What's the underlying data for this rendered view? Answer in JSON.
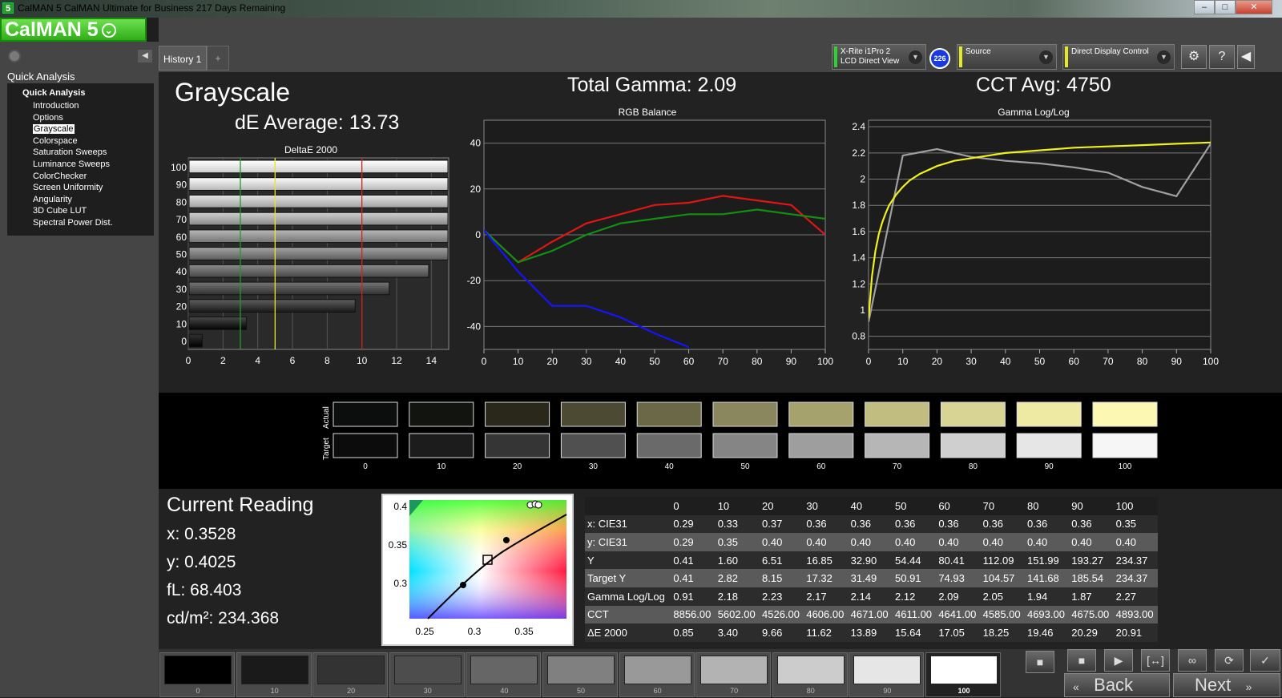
{
  "window": {
    "title": "CalMAN 5 CalMAN Ultimate for Business 217 Days Remaining",
    "app_icon": "5",
    "minimize": "–",
    "maximize": "□",
    "close": "✕"
  },
  "logo": {
    "text": "CalMAN 5",
    "caret": "⌄"
  },
  "sidebar": {
    "heading": "Quick Analysis",
    "collapse": "◀",
    "root": "Quick Analysis",
    "items": [
      "Introduction",
      "Options",
      "Grayscale",
      "Colorspace",
      "Saturation Sweeps",
      "Luminance Sweeps",
      "ColorChecker",
      "Screen Uniformity",
      "Angularity",
      "3D Cube LUT",
      "Spectral Power Dist."
    ],
    "selected": "Grayscale"
  },
  "tabs": [
    {
      "label": "History 1"
    }
  ],
  "tab_add": "+",
  "devices": {
    "meter": {
      "line1": "X-Rite i1Pro 2",
      "line2": "LCD Direct View",
      "color": "#2fd12f"
    },
    "badge": "226",
    "source": {
      "label": "Source",
      "color": "#e6e62a"
    },
    "display": {
      "label": "Direct Display Control",
      "color": "#e6e62a"
    }
  },
  "toolbar": {
    "settings": "⚙",
    "help": "?",
    "collapse": "◀"
  },
  "headings": {
    "title": "Grayscale",
    "de_avg": "dE Average: 13.73",
    "gamma": "Total Gamma: 2.09",
    "cct": "CCT Avg: 4750"
  },
  "chart_data": [
    {
      "type": "bar",
      "title": "DeltaE 2000",
      "orientation": "horizontal",
      "categories": [
        100,
        90,
        80,
        70,
        60,
        50,
        40,
        30,
        20,
        10,
        0
      ],
      "values": [
        20.91,
        20.29,
        19.46,
        18.25,
        17.05,
        15.64,
        13.89,
        11.62,
        9.66,
        3.4,
        0.85
      ],
      "xlim": [
        0,
        15
      ],
      "xticks": [
        0,
        2,
        4,
        6,
        8,
        10,
        12,
        14
      ],
      "thresholds": [
        {
          "value": 3,
          "color": "#1fa01f"
        },
        {
          "value": 5,
          "color": "#e6e62a"
        },
        {
          "value": 10,
          "color": "#d42020"
        }
      ],
      "grid": true
    },
    {
      "type": "line",
      "title": "RGB Balance",
      "x": [
        0,
        10,
        20,
        30,
        40,
        50,
        60,
        70,
        80,
        90,
        100
      ],
      "xticks": [
        0,
        10,
        20,
        30,
        40,
        50,
        60,
        70,
        80,
        90,
        100
      ],
      "ylim": [
        -50,
        50
      ],
      "yticks": [
        40,
        20,
        0,
        -20,
        -40
      ],
      "series": [
        {
          "color": "#e01515",
          "values": [
            2,
            -12,
            -3,
            5,
            9,
            13,
            14,
            17,
            15,
            13,
            0
          ]
        },
        {
          "color": "#129012",
          "values": [
            2,
            -12,
            -7,
            0,
            5,
            7,
            9,
            9,
            11,
            9,
            7
          ]
        },
        {
          "color": "#1414ff",
          "values": [
            2,
            -16,
            -31,
            -31,
            -36,
            -43,
            -49,
            null,
            null,
            null,
            null
          ]
        }
      ],
      "grid": true
    },
    {
      "type": "line",
      "title": "Gamma Log/Log",
      "x": [
        0,
        10,
        20,
        30,
        40,
        50,
        60,
        70,
        80,
        90,
        100
      ],
      "xticks": [
        0,
        10,
        20,
        30,
        40,
        50,
        60,
        70,
        80,
        90,
        100
      ],
      "ylim": [
        0.7,
        2.45
      ],
      "yticks": [
        2.4,
        2.2,
        2,
        1.8,
        1.6,
        1.4,
        1.2,
        1,
        0.8
      ],
      "series": [
        {
          "color": "#a0a0a0",
          "values": [
            0.91,
            2.18,
            2.23,
            2.17,
            2.14,
            2.12,
            2.09,
            2.05,
            1.94,
            1.87,
            2.27
          ]
        },
        {
          "color": "#f0f01c",
          "x": [
            0,
            1,
            2,
            3,
            4,
            5,
            6,
            7,
            8,
            10,
            12,
            15,
            20,
            25,
            30,
            40,
            50,
            60,
            70,
            80,
            90,
            100
          ],
          "values": [
            0.94,
            1.26,
            1.45,
            1.58,
            1.67,
            1.74,
            1.8,
            1.84,
            1.88,
            1.94,
            1.99,
            2.04,
            2.1,
            2.14,
            2.16,
            2.2,
            2.22,
            2.24,
            2.25,
            2.26,
            2.27,
            2.28
          ]
        }
      ],
      "grid": true
    }
  ],
  "swatches": {
    "actual_label": "Actual",
    "target_label": "Target",
    "levels": [
      "0",
      "10",
      "20",
      "30",
      "40",
      "50",
      "60",
      "70",
      "80",
      "90",
      "100"
    ],
    "actual": [
      "#0c0d0d",
      "#121410",
      "#2a281a",
      "#4c4a32",
      "#6b6848",
      "#8a875e",
      "#a6a26e",
      "#c1bd80",
      "#d8d494",
      "#eeeaa4",
      "#fcf8b4"
    ],
    "target": [
      "#0c0c0c",
      "#1c1c1c",
      "#353535",
      "#505050",
      "#6a6a6a",
      "#858585",
      "#9e9e9e",
      "#b6b6b6",
      "#cfcfcf",
      "#e6e6e6",
      "#f6f6f6"
    ]
  },
  "reading": {
    "title": "Current Reading",
    "x": "x: 0.3528",
    "y": "y: 0.4025",
    "fl": "fL: 68.403",
    "cdm2": "cd/m²: 234.368"
  },
  "cie": {
    "yticks": [
      "0.4",
      "0.35",
      "0.3"
    ],
    "xticks": [
      "0.25",
      "0.3",
      "0.35"
    ]
  },
  "table": {
    "header": [
      "",
      "0",
      "10",
      "20",
      "30",
      "40",
      "50",
      "60",
      "70",
      "80",
      "90",
      "100"
    ],
    "rows": [
      [
        "x: CIE31",
        "0.29",
        "0.33",
        "0.37",
        "0.36",
        "0.36",
        "0.36",
        "0.36",
        "0.36",
        "0.36",
        "0.36",
        "0.35"
      ],
      [
        "y: CIE31",
        "0.29",
        "0.35",
        "0.40",
        "0.40",
        "0.40",
        "0.40",
        "0.40",
        "0.40",
        "0.40",
        "0.40",
        "0.40"
      ],
      [
        "Y",
        "0.41",
        "1.60",
        "6.51",
        "16.85",
        "32.90",
        "54.44",
        "80.41",
        "112.09",
        "151.99",
        "193.27",
        "234.37"
      ],
      [
        "Target Y",
        "0.41",
        "2.82",
        "8.15",
        "17.32",
        "31.49",
        "50.91",
        "74.93",
        "104.57",
        "141.68",
        "185.54",
        "234.37"
      ],
      [
        "Gamma Log/Log",
        "0.91",
        "2.18",
        "2.23",
        "2.17",
        "2.14",
        "2.12",
        "2.09",
        "2.05",
        "1.94",
        "1.87",
        "2.27"
      ],
      [
        "CCT",
        "8856.00",
        "5602.00",
        "4526.00",
        "4606.00",
        "4671.00",
        "4611.00",
        "4641.00",
        "4585.00",
        "4693.00",
        "4675.00",
        "4893.00"
      ],
      [
        "ΔE 2000",
        "0.85",
        "3.40",
        "9.66",
        "11.62",
        "13.89",
        "15.64",
        "17.05",
        "18.25",
        "19.46",
        "20.29",
        "20.91"
      ]
    ]
  },
  "patches": [
    {
      "label": "0",
      "color": "#000000"
    },
    {
      "label": "10",
      "color": "#1a1a1a"
    },
    {
      "label": "20",
      "color": "#333333"
    },
    {
      "label": "30",
      "color": "#4d4d4d"
    },
    {
      "label": "40",
      "color": "#666666"
    },
    {
      "label": "50",
      "color": "#808080"
    },
    {
      "label": "60",
      "color": "#999999"
    },
    {
      "label": "70",
      "color": "#b3b3b3"
    },
    {
      "label": "80",
      "color": "#cccccc"
    },
    {
      "label": "90",
      "color": "#e6e6e6"
    },
    {
      "label": "100",
      "color": "#ffffff",
      "active": true
    }
  ],
  "controls": {
    "back": "Back",
    "next": "Next",
    "back_arrow": "«",
    "next_arrow": "»",
    "stop": "■",
    "play": "▶",
    "range": "[↔]",
    "loop": "∞",
    "refresh": "⟳",
    "check": "✓",
    "record": "■"
  }
}
